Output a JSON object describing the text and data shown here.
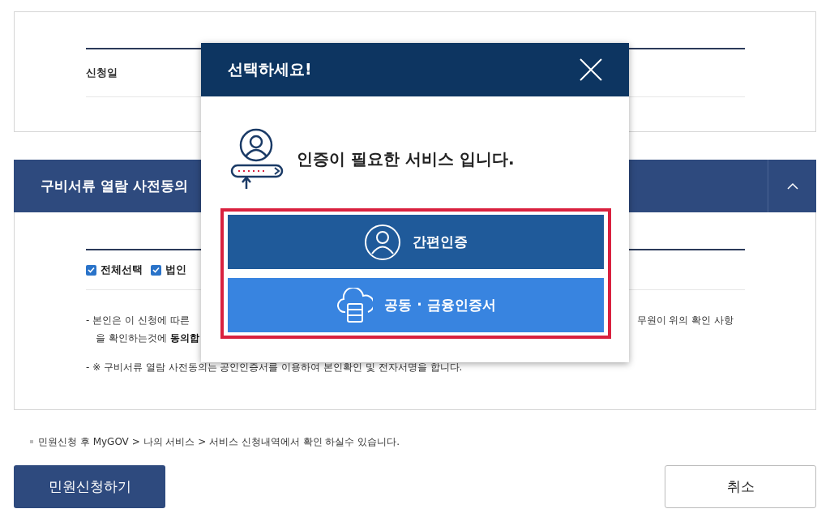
{
  "application_card": {
    "date_label": "신청일"
  },
  "consent_section": {
    "title": "구비서류 열람 사전동의",
    "expanded": true,
    "checkboxes": [
      {
        "label": "전체선택",
        "checked": true
      },
      {
        "label": "법인",
        "checked": true
      }
    ],
    "notice_lines": [
      "- 본인은 이 신청에 따른",
      "을 확인하는것에 **동의합**",
      "- ※ 구비서류 열람 사전동의는 공인인증서를 이용하여 본인확인 및 전자서명을 합니다."
    ],
    "notice_right_fragment": "무원이 위의 확인 사항"
  },
  "footer_note": "민원신청 후 MyGOV > 나의 서비스 > 서비스 신청내역에서 확인 하실수 있습니다.",
  "buttons": [
    {
      "kind": "primary",
      "label": "민원신청하기"
    },
    {
      "kind": "secondary",
      "label": "취소"
    }
  ],
  "modal": {
    "title": "선택하세요!",
    "message": "인증이 필요한 서비스 입니다.",
    "options_highlighted": true,
    "options": [
      {
        "kind": "simple",
        "label": "간편인증"
      },
      {
        "kind": "certificate",
        "label": "공동 · 금융인증서"
      }
    ]
  }
}
